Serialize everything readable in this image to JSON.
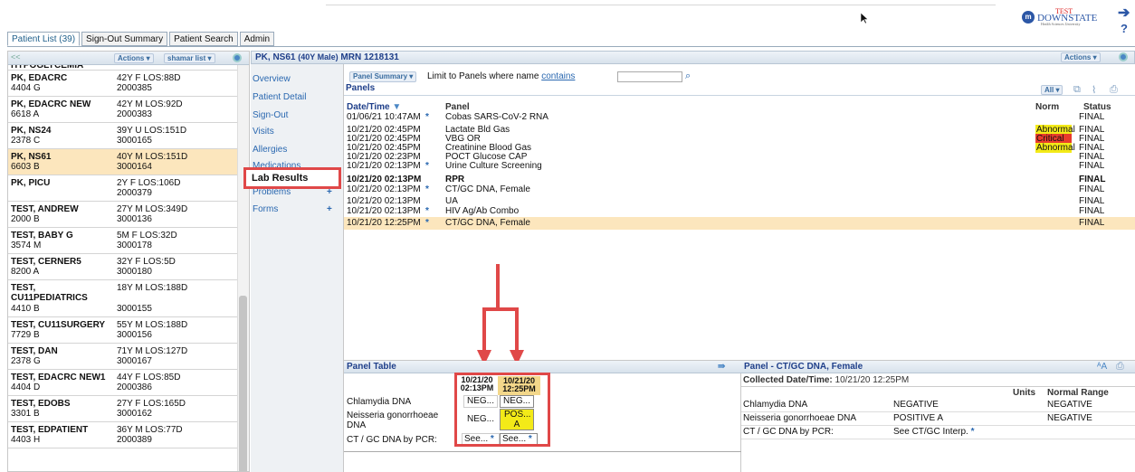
{
  "branding": {
    "circle": "m",
    "name": "DOWNSTATE",
    "tag": "TEST",
    "sub": "Health Sciences University"
  },
  "tabs": [
    "Patient List (39)",
    "Sign-Out Summary",
    "Patient Search",
    "Admin"
  ],
  "left_header": {
    "collapse": "<<",
    "actions": "Actions",
    "list": "shamar list"
  },
  "patients": [
    {
      "name": "HYPOGLYCEMIA",
      "demo": "",
      "loc": "",
      "mrn": "",
      "partial": true
    },
    {
      "name": "PK, EDACRC",
      "demo": "42Y F LOS:88D",
      "loc": "4404 G",
      "mrn": "2000385"
    },
    {
      "name": "PK, EDACRC NEW",
      "demo": "42Y M LOS:92D",
      "loc": "6618 A",
      "mrn": "2000383"
    },
    {
      "name": "PK, NS24",
      "demo": "39Y U LOS:151D",
      "loc": "2378 C",
      "mrn": "3000165"
    },
    {
      "name": "PK, NS61",
      "demo": "40Y M LOS:151D",
      "loc": "6603 B",
      "mrn": "3000164",
      "selected": true
    },
    {
      "name": "PK, PICU",
      "demo": "2Y F LOS:106D",
      "loc": "",
      "mrn": "2000379"
    },
    {
      "name": "TEST, ANDREW",
      "demo": "27Y M LOS:349D",
      "loc": "2000 B",
      "mrn": "3000136"
    },
    {
      "name": "TEST, BABY G",
      "demo": "5M F LOS:32D",
      "loc": "3574 M",
      "mrn": "3000178"
    },
    {
      "name": "TEST, CERNER5",
      "demo": "32Y F LOS:5D",
      "loc": "8200 A",
      "mrn": "3000180"
    },
    {
      "name": "TEST, CU11PEDIATRICS",
      "demo": "18Y M LOS:188D",
      "loc": "4410 B",
      "mrn": "3000155"
    },
    {
      "name": "TEST, CU11SURGERY",
      "demo": "55Y M LOS:188D",
      "loc": "7729 B",
      "mrn": "3000156"
    },
    {
      "name": "TEST, DAN",
      "demo": "71Y M LOS:127D",
      "loc": "2378 G",
      "mrn": "3000167"
    },
    {
      "name": "TEST, EDACRC NEW1",
      "demo": "44Y F LOS:85D",
      "loc": "4404 D",
      "mrn": "2000386"
    },
    {
      "name": "TEST, EDOBS",
      "demo": "27Y F LOS:165D",
      "loc": "3301 B",
      "mrn": "3000162"
    },
    {
      "name": "TEST, EDPATIENT",
      "demo": "36Y M LOS:77D",
      "loc": "4403 H",
      "mrn": "2000389"
    }
  ],
  "patient_header": {
    "name": "PK, NS61",
    "demo": "(40Y Male)",
    "mrn": "MRN 1218131",
    "actions": "Actions"
  },
  "nav": [
    "Overview",
    "Patient Detail",
    "Sign-Out",
    "Visits",
    "Allergies",
    "Medications",
    "Lab Results",
    "Problems",
    "Forms"
  ],
  "panels": {
    "summary_btn": "Panel Summary",
    "limit_text": "Limit to Panels where name",
    "contains": "contains",
    "title": "Panels",
    "all_btn": "All",
    "headers": {
      "datetime": "Date/Time",
      "panel": "Panel",
      "norm": "Norm",
      "status": "Status"
    },
    "rows": [
      {
        "dt": "01/06/21 10:47AM",
        "star": "*",
        "panel": "Cobas SARS-CoV-2 RNA",
        "norm": "",
        "status": "FINAL"
      },
      {
        "dt": "10/21/20 02:45PM",
        "star": "",
        "panel": "Lactate Bld Gas",
        "norm": "Abnormal",
        "status": "FINAL"
      },
      {
        "dt": "10/21/20 02:45PM",
        "star": "",
        "panel": "VBG OR",
        "norm": "Critical",
        "status": "FINAL"
      },
      {
        "dt": "10/21/20 02:45PM",
        "star": "",
        "panel": "Creatinine Blood Gas",
        "norm": "Abnormal",
        "status": "FINAL"
      },
      {
        "dt": "10/21/20 02:23PM",
        "star": "",
        "panel": "POCT Glucose CAP",
        "norm": "",
        "status": "FINAL"
      },
      {
        "dt": "10/21/20 02:13PM",
        "star": "*",
        "panel": "Urine Culture Screening",
        "norm": "",
        "status": "FINAL"
      },
      {
        "dt": "10/21/20 02:13PM",
        "star": "",
        "panel": "RPR",
        "norm": "",
        "status": "FINAL",
        "bold": true
      },
      {
        "dt": "10/21/20 02:13PM",
        "star": "*",
        "panel": "CT/GC DNA, Female",
        "norm": "",
        "status": "FINAL"
      },
      {
        "dt": "10/21/20 02:13PM",
        "star": "",
        "panel": "UA",
        "norm": "",
        "status": "FINAL"
      },
      {
        "dt": "10/21/20 02:13PM",
        "star": "*",
        "panel": "HIV Ag/Ab Combo",
        "norm": "",
        "status": "FINAL"
      },
      {
        "dt": "10/21/20 12:25PM",
        "star": "*",
        "panel": "CT/GC DNA, Female",
        "norm": "",
        "status": "FINAL",
        "selected": true
      }
    ]
  },
  "panel_table": {
    "title": "Panel Table",
    "col1": {
      "date": "10/21/20",
      "time": "02:13PM"
    },
    "col2": {
      "date": "10/21/20",
      "time": "12:25PM"
    },
    "rows": [
      {
        "label": "Chlamydia DNA",
        "v1": "NEG...",
        "v2": "NEG..."
      },
      {
        "label": "Neisseria gonorrhoeae DNA",
        "v1": "NEG...",
        "v2": "POS... A"
      },
      {
        "label": "CT / GC DNA by PCR:",
        "v1": "See...",
        "v2": "See..."
      }
    ]
  },
  "panel_detail": {
    "title": "Panel - CT/GC DNA, Female",
    "collected_label": "Collected Date/Time:",
    "collected_value": "10/21/20 12:25PM",
    "units_header": "Units",
    "range_header": "Normal Range",
    "rows": [
      {
        "label": "Chlamydia DNA",
        "value": "NEGATIVE",
        "units": "",
        "range": "NEGATIVE"
      },
      {
        "label": "Neisseria gonorrhoeae DNA",
        "value": "POSITIVE A",
        "units": "",
        "range": "NEGATIVE"
      },
      {
        "label": "CT / GC DNA by PCR:",
        "value": "See CT/GC Interp.",
        "units": "",
        "range": ""
      }
    ]
  },
  "colors": {
    "accent": "#1f3f8a",
    "link": "#2a68b0",
    "selected": "#fce6bd",
    "abnormal": "#f3ea18",
    "critical": "#e83b2c",
    "highlight": "#e04848"
  }
}
